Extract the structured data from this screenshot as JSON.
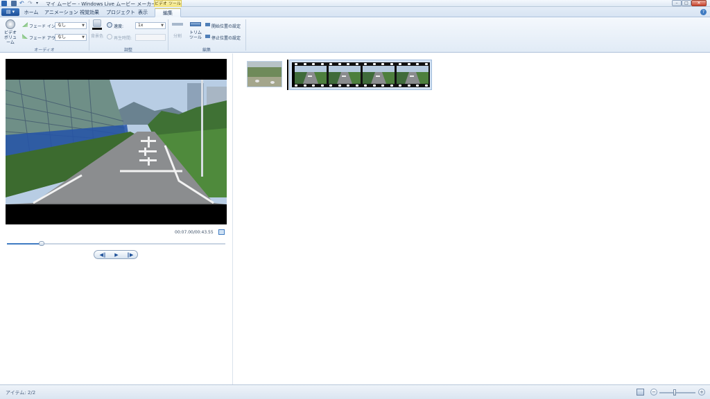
{
  "window": {
    "title": "マイ ムービー - Windows Live ムービー メーカー",
    "context_tab_header": "ビデオ ツール",
    "buttons": [
      "minimize",
      "maximize",
      "close"
    ]
  },
  "tabs": [
    {
      "label": "ホーム"
    },
    {
      "label": "アニメーション"
    },
    {
      "label": "視覚効果"
    },
    {
      "label": "プロジェクト"
    },
    {
      "label": "表示"
    },
    {
      "label": "編集",
      "active": true
    }
  ],
  "ribbon": {
    "audio": {
      "group_label": "オーディオ",
      "video_volume_label": "ビデオ\nボリューム",
      "fade_in_label": "フェード イン:",
      "fade_in_value": "なし",
      "fade_out_label": "フェード アウト:",
      "fade_out_value": "なし"
    },
    "adjust": {
      "group_label": "調整",
      "background_color_label": "背景色",
      "speed_label": "速度:",
      "speed_value": "1x",
      "duration_label": "再生時間:",
      "duration_value": ""
    },
    "edit": {
      "group_label": "編集",
      "split_label": "分割",
      "trim_tool_label": "トリム\nツール",
      "set_start_label": "開始位置の設定",
      "set_end_label": "停止位置の設定"
    }
  },
  "preview": {
    "time_readout": "00:07.00/00:43.55",
    "playback_fraction": 0.16
  },
  "statusbar": {
    "items_text": "アイテム: 2/2",
    "zoom_fraction": 0.42
  },
  "colors": {
    "accent": "#3f7bc2",
    "context_tab": "#f2e37a",
    "ribbon_bg": "#e1ebf6"
  }
}
